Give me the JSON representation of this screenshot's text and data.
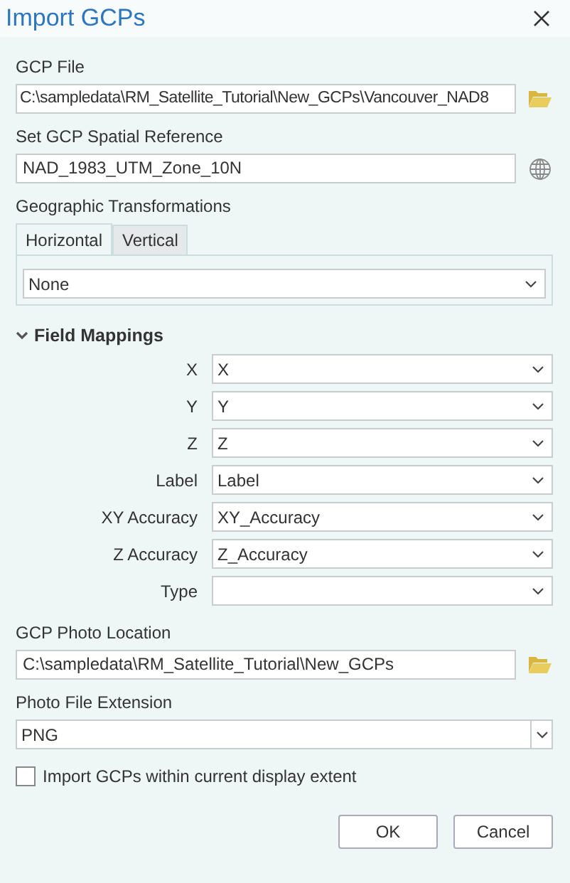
{
  "window": {
    "title": "Import GCPs"
  },
  "gcp_file": {
    "label": "GCP File",
    "value": "C:\\sampledata\\RM_Satellite_Tutorial\\New_GCPs\\Vancouver_NAD8"
  },
  "spatial_reference": {
    "label": "Set GCP Spatial Reference",
    "value": "NAD_1983_UTM_Zone_10N"
  },
  "geographic_transformations": {
    "label": "Geographic Transformations",
    "tabs": [
      {
        "label": "Horizontal",
        "selected": true
      },
      {
        "label": "Vertical",
        "selected": false
      }
    ],
    "value": "None"
  },
  "field_mappings": {
    "label": "Field Mappings",
    "expanded": true,
    "rows": [
      {
        "label": "X",
        "value": "X"
      },
      {
        "label": "Y",
        "value": "Y"
      },
      {
        "label": "Z",
        "value": "Z"
      },
      {
        "label": "Label",
        "value": "Label"
      },
      {
        "label": "XY Accuracy",
        "value": "XY_Accuracy"
      },
      {
        "label": "Z Accuracy",
        "value": "Z_Accuracy"
      },
      {
        "label": "Type"
      }
    ]
  },
  "photo_location": {
    "label": "GCP Photo Location",
    "value": "C:\\sampledata\\RM_Satellite_Tutorial\\New_GCPs"
  },
  "photo_extension": {
    "label": "Photo File Extension",
    "value": "PNG"
  },
  "display_extent": {
    "label": "Import GCPs within current display extent",
    "checked": false
  },
  "buttons": [
    "OK",
    "Cancel"
  ]
}
